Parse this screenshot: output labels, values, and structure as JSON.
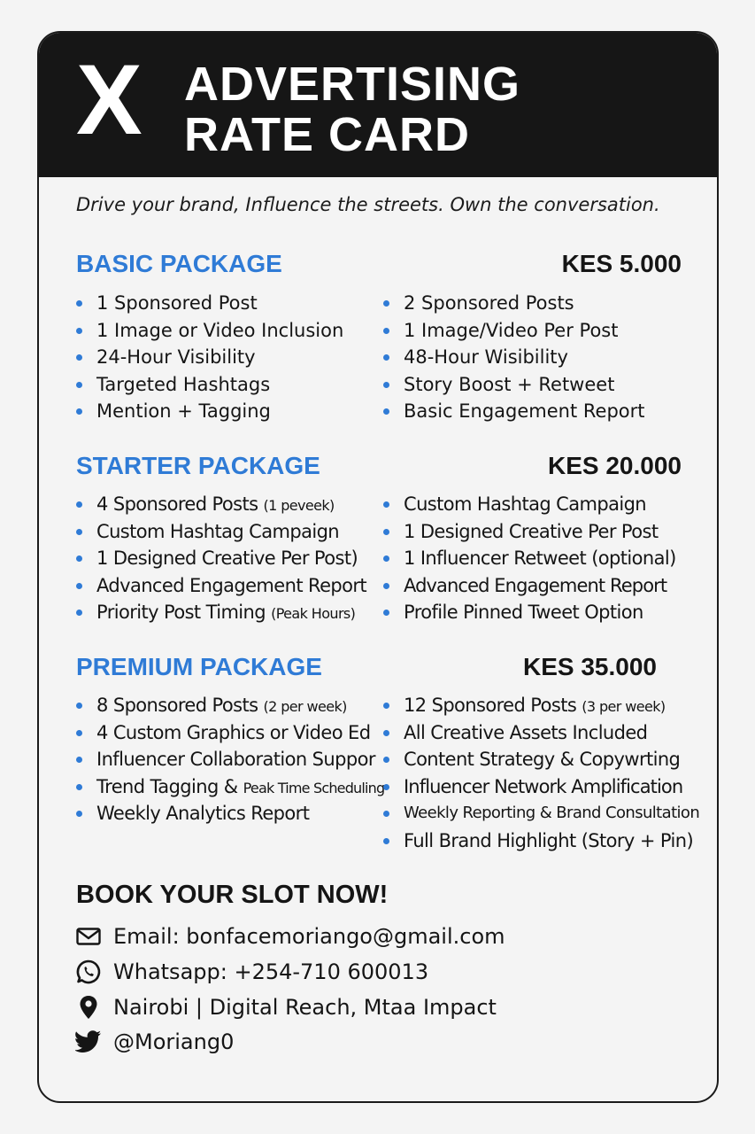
{
  "header": {
    "logo": "X",
    "title_line1": "ADVERTISING",
    "title_line2": "RATE CARD"
  },
  "tagline": "Drive your brand, Influence the streets. Own the conversation.",
  "packages": [
    {
      "name": "BASIC PACKAGE",
      "price": "KES 5.000",
      "left": [
        {
          "text": "1 Sponsored Post"
        },
        {
          "text": "1 Image or Video Inclusion"
        },
        {
          "text": "24-Hour Visibility"
        },
        {
          "text": "Targeted Hashtags"
        },
        {
          "text": "Mention + Tagging"
        }
      ],
      "right": [
        {
          "text": "2 Sponsored Posts"
        },
        {
          "text": "1 Image/Video Per Post"
        },
        {
          "text": "48-Hour Wisibility"
        },
        {
          "text": "Story Boost + Retweet"
        },
        {
          "text": "Basic Engagement Report"
        }
      ]
    },
    {
      "name": "STARTER PACKAGE",
      "price": "KES 20.000",
      "left": [
        {
          "text": "4 Sponsored Posts ",
          "note": "(1 peveek)"
        },
        {
          "text": "Custom Hashtag Campaign"
        },
        {
          "text": "1 Designed Creative Per Post)"
        },
        {
          "text": "Advanced Engagement Report"
        },
        {
          "text": "Priority Post Timing ",
          "note": "(Peak Hours)"
        }
      ],
      "right": [
        {
          "text": "Custom Hashtag Campaign"
        },
        {
          "text": "1 Designed Creative Per Post"
        },
        {
          "text": "1 Influencer Retweet (optional)"
        },
        {
          "text": "Advanced Engagement Report"
        },
        {
          "text": "Profile Pinned Tweet Option"
        }
      ]
    },
    {
      "name": "PREMIUM PACKAGE",
      "price": "KES 35.000",
      "left": [
        {
          "text": "8 Sponsored Posts ",
          "note": "(2 per week)"
        },
        {
          "text": "4 Custom Graphics or Video Ed"
        },
        {
          "text": "Influencer Collaboration Suppor"
        },
        {
          "text": "Trend Tagging & ",
          "note": "Peak Time Scheduling"
        },
        {
          "text": "Weekly Analytics Report"
        }
      ],
      "right": [
        {
          "text": "12 Sponsored Posts ",
          "note": "(3 per week)"
        },
        {
          "text": "All Creative Assets Included"
        },
        {
          "text": "Content Strategy & Copywrting"
        },
        {
          "text": "Influencer Network Amplification"
        },
        {
          "text": "Weekly Reporting & Brand Consultation"
        },
        {
          "text": "Full Brand Highlight (Story + Pin)"
        }
      ]
    }
  ],
  "cta": "BOOK YOUR SLOT NOW!",
  "contacts": {
    "email": "Email: bonfacemoriango@gmail.com",
    "whatsapp": "Whatsapp: +254-710 600013",
    "location": "Nairobi | Digital Reach, Mtaa Impact",
    "twitter": "@Moriang0"
  },
  "icons": {
    "email": "envelope-icon",
    "whatsapp": "whatsapp-icon",
    "location": "location-pin-icon",
    "twitter": "twitter-bird-icon"
  },
  "colors": {
    "accent": "#2f7bd6",
    "header_bg": "#161616",
    "page_bg": "#f4f4f4",
    "text": "#151515"
  }
}
